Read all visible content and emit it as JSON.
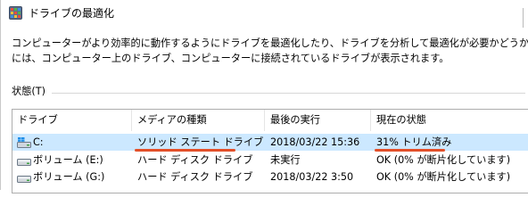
{
  "window": {
    "title": "ドライブの最適化",
    "app_icon": "defrag-app-icon"
  },
  "description": {
    "line1": "コンピューターがより効率的に動作するようにドライブを最適化したり、ドライブを分析して最適化が必要かどうかを確認したりできます",
    "line2": "には、コンピューター上のドライブ、コンピューターに接続されているドライブが表示されます。"
  },
  "status_section": {
    "label": "状態(T)"
  },
  "table": {
    "columns": [
      "ドライブ",
      "メディアの種類",
      "最後の実行",
      "現在の状態"
    ],
    "rows": [
      {
        "drive": "C:",
        "media": "ソリッド ステート ドライブ",
        "last_run": "2018/03/22 15:36",
        "status": "31% トリム済み",
        "icon": "windows-drive-icon",
        "selected": true
      },
      {
        "drive": "ボリューム (E:)",
        "media": "ハード ディスク ドライブ",
        "last_run": "未実行",
        "status": "OK (0% が断片化しています)",
        "icon": "hard-disk-icon",
        "selected": false
      },
      {
        "drive": "ボリューム (G:)",
        "media": "ハード ディスク ドライブ",
        "last_run": "2018/03/22 3:50",
        "status": "OK (0% が断片化しています)",
        "icon": "hard-disk-icon",
        "selected": false
      }
    ]
  },
  "colors": {
    "selection": "#cce8ff",
    "annotation_underline": "#e3502a"
  }
}
